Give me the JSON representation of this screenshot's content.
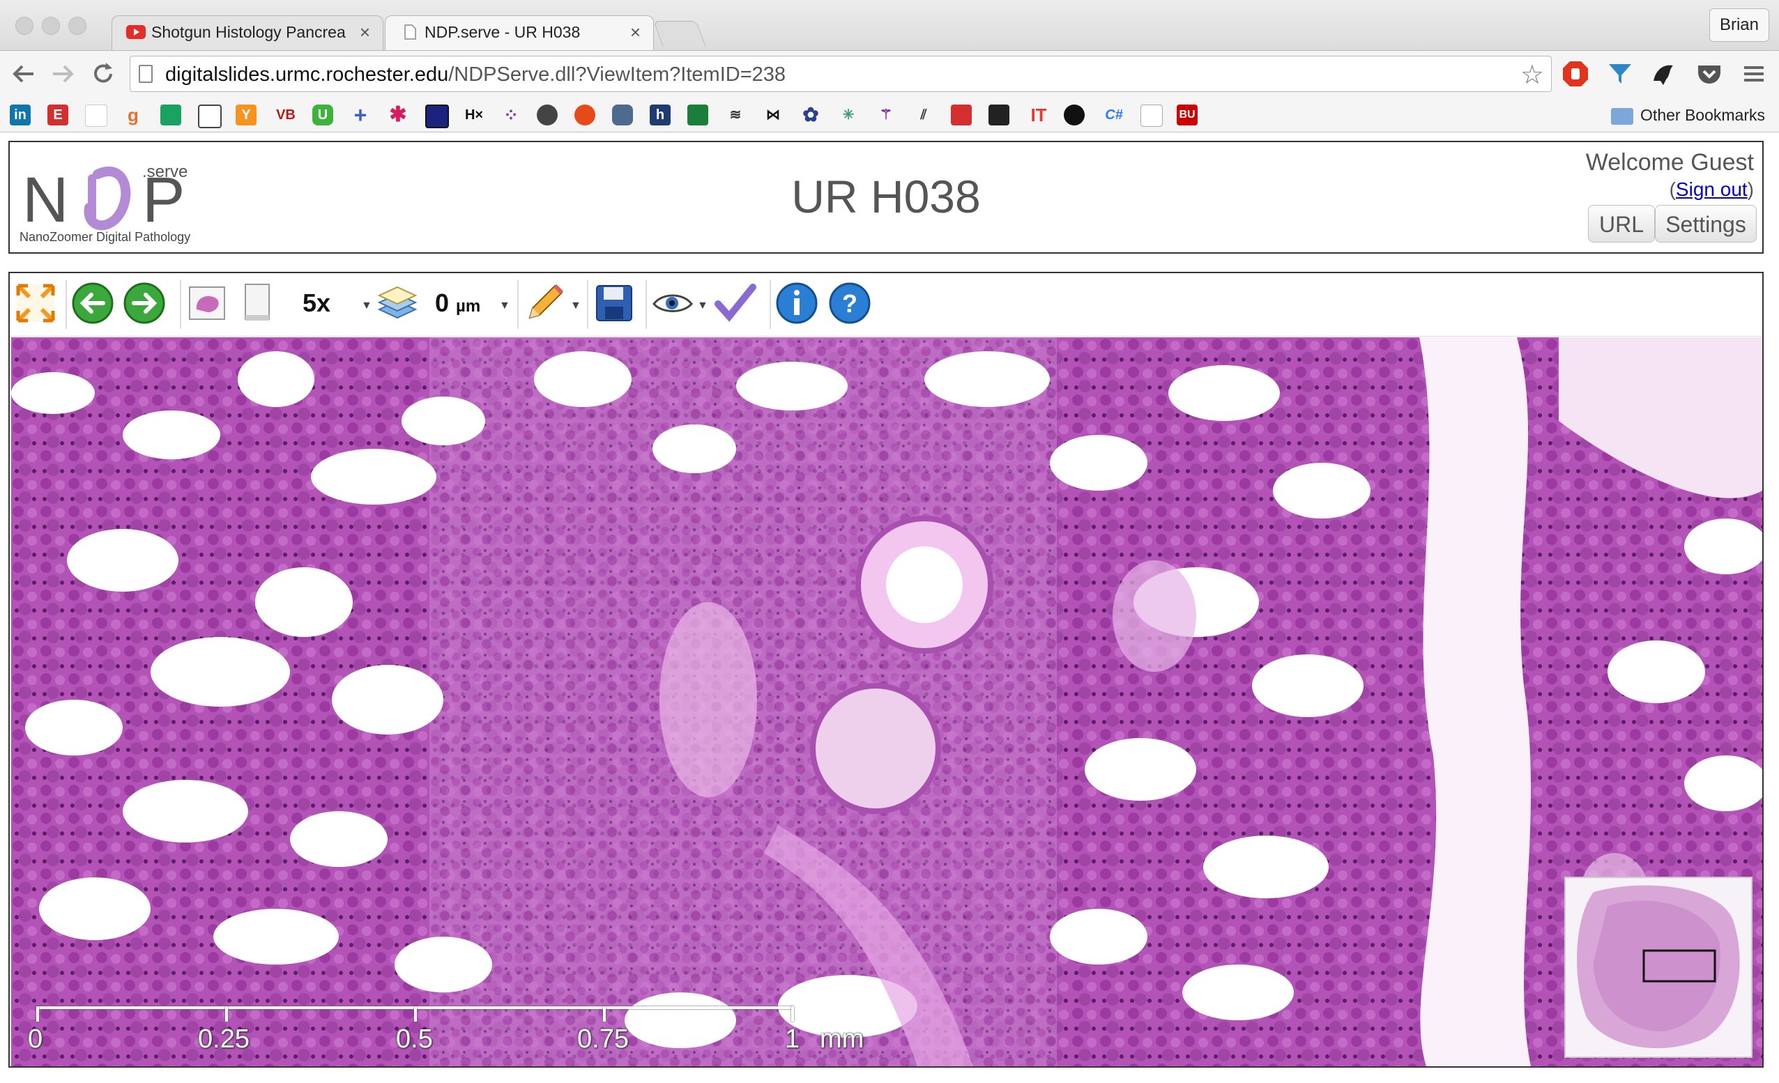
{
  "browser": {
    "tabs": [
      {
        "title": "Shotgun Histology Pancrea",
        "icon": "youtube-icon",
        "active": false
      },
      {
        "title": "NDP.serve - UR H038",
        "icon": "page-icon",
        "active": true
      }
    ],
    "close_glyph": "×",
    "user": "Brian",
    "url_host": "digitalslides.urmc.rochester.edu",
    "url_path": "/NDPServe.dll?ViewItem?ItemID=238",
    "other_bookmarks": "Other Bookmarks",
    "bookmark_labels": [
      "in",
      "E",
      "g",
      "VB",
      "U",
      "H×",
      "C#",
      "BU",
      "IT"
    ]
  },
  "ndp": {
    "logo_serve": ".serve",
    "logo_tagline": "NanoZoomer Digital Pathology",
    "title": "UR H038",
    "welcome": "Welcome Guest",
    "signout_prefix": "(",
    "signout_link": "Sign out",
    "signout_suffix": ")",
    "btn_url": "URL",
    "btn_settings": "Settings"
  },
  "viewer": {
    "magnification": "5x",
    "focus_value": "0",
    "focus_unit": "µm",
    "scale_labels": [
      "0",
      "0.25",
      "0.5",
      "0.75",
      "1",
      "mm"
    ],
    "colors": {
      "tissue_dark": "#a23aa8",
      "tissue_mid": "#c979cf",
      "tissue_light": "#f2d6f1"
    }
  }
}
